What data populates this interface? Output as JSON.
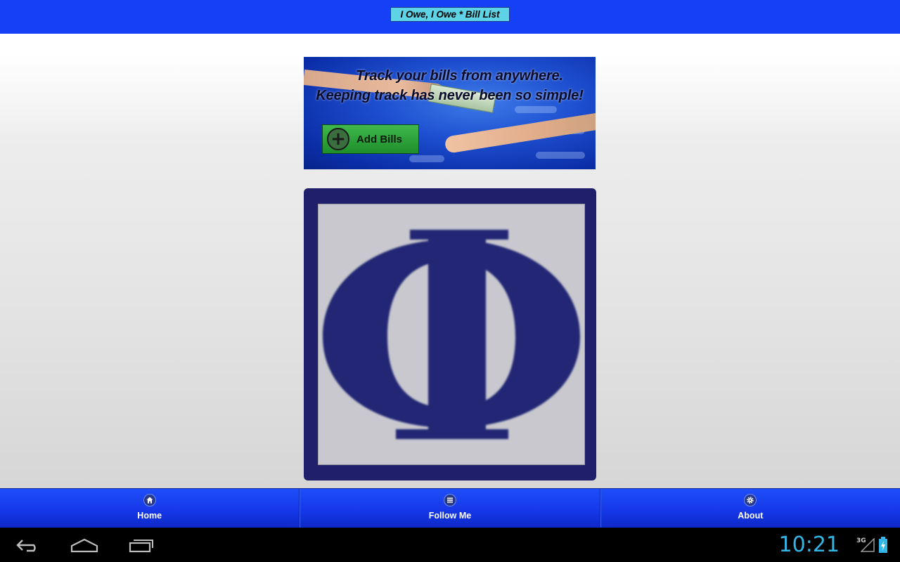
{
  "header": {
    "title": "I Owe, I Owe * Bill List"
  },
  "banner": {
    "line1": "Track your bills from anywhere.",
    "line2": "Keeping track has never been so simple!",
    "button_label": "Add Bills",
    "button_icon": "plus-circle-icon"
  },
  "logo": {
    "symbol": "phi-logo"
  },
  "footer": {
    "tabs": [
      {
        "label": "Home",
        "icon": "home-icon"
      },
      {
        "label": "Follow Me",
        "icon": "menu-lines-icon"
      },
      {
        "label": "About",
        "icon": "gear-icon"
      }
    ]
  },
  "status_bar": {
    "time": "10:21",
    "network": "3G"
  },
  "colors": {
    "header_blue": "#1540f5",
    "title_bg": "#5fd3e6",
    "logo_navy": "#1f1f6b",
    "clock_blue": "#33b5e5"
  }
}
